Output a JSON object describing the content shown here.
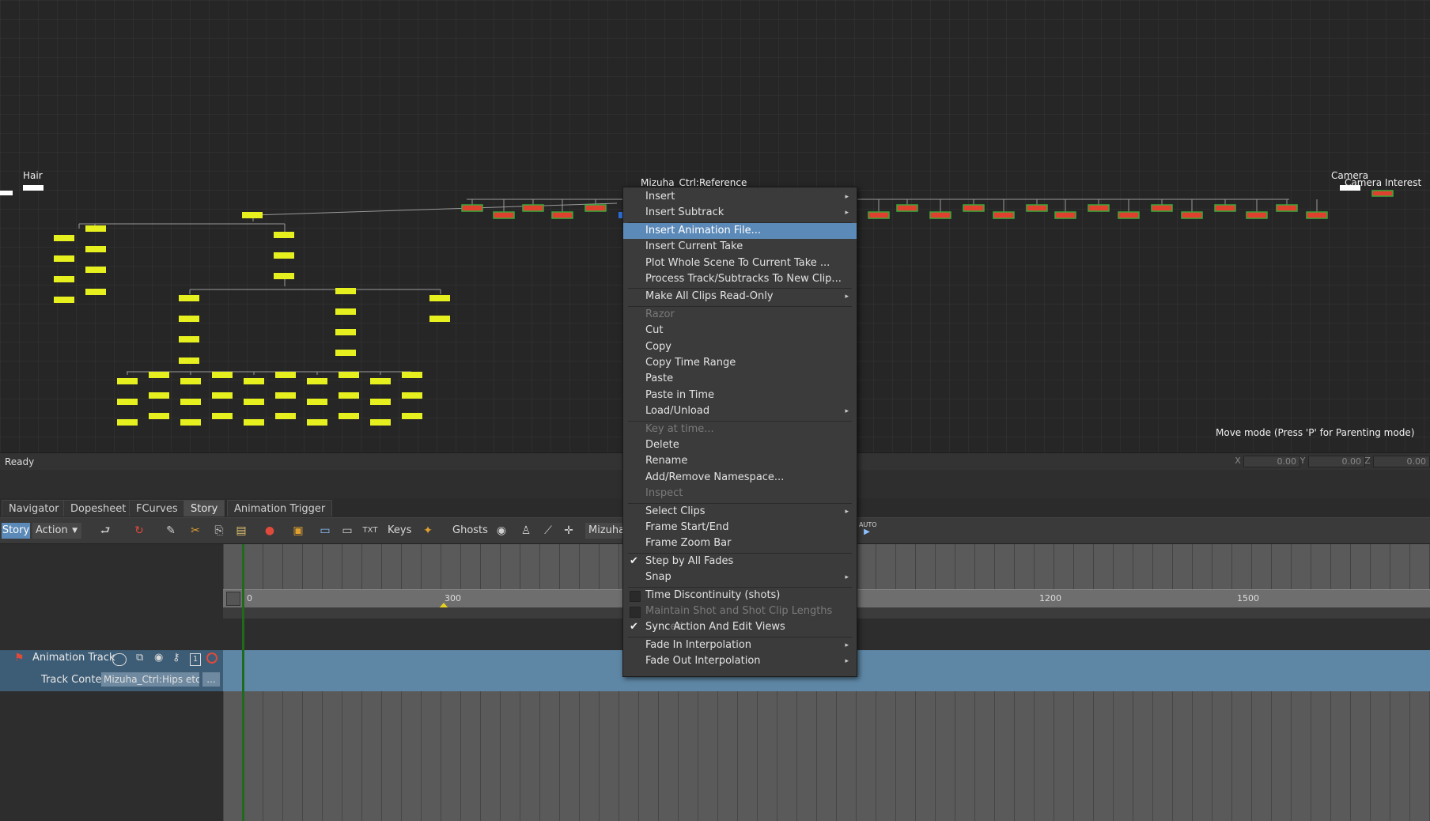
{
  "viewer": {
    "node_labels": {
      "hair": "Hair",
      "reference": "Mizuha_Ctrl:Reference",
      "camera": "Camera",
      "camera_interest": "Camera Interest"
    },
    "mode_hint": "Move mode (Press 'P' for Parenting mode)"
  },
  "status": {
    "text": "Ready",
    "coords": [
      {
        "axis": "X",
        "value": "0.00"
      },
      {
        "axis": "Y",
        "value": "0.00"
      },
      {
        "axis": "Z",
        "value": "0.00"
      }
    ]
  },
  "tabs": [
    "Navigator",
    "Dopesheet",
    "FCurves",
    "Story",
    "Animation Trigger"
  ],
  "active_tab": "Story",
  "toolbar": {
    "story_label": "Story",
    "action_label": "Action",
    "keys_label": "Keys",
    "ghosts_label": "Ghosts",
    "char_label": "Mizuha_",
    "auto_label": "AUTO"
  },
  "ruler": {
    "labels": [
      "0",
      "300",
      "1200",
      "1500"
    ]
  },
  "track": {
    "name": "Animation Track",
    "content_label": "Track Conten",
    "content_value": "Mizuha_Ctrl:Hips etc.",
    "more_label": "..."
  },
  "context_menu": {
    "items": [
      {
        "label": "Insert",
        "submenu": true
      },
      {
        "label": "Insert Subtrack",
        "submenu": true
      },
      {
        "label": "Insert Animation File...",
        "highlight": true
      },
      {
        "label": "Insert Current Take"
      },
      {
        "label": "Plot Whole Scene To Current Take ..."
      },
      {
        "label": "Process Track/Subtracks To New Clip..."
      },
      {
        "label": "Make All Clips Read-Only",
        "submenu": true
      },
      {
        "label": "Razor",
        "disabled": true
      },
      {
        "label": "Cut"
      },
      {
        "label": "Copy"
      },
      {
        "label": "Copy Time Range"
      },
      {
        "label": "Paste"
      },
      {
        "label": "Paste in Time"
      },
      {
        "label": "Load/Unload",
        "submenu": true
      },
      {
        "label": "Key at time...",
        "disabled": true
      },
      {
        "label": "Delete"
      },
      {
        "label": "Rename"
      },
      {
        "label": "Add/Remove Namespace..."
      },
      {
        "label": "Inspect",
        "disabled": true
      },
      {
        "label": "Select Clips",
        "submenu": true
      },
      {
        "label": "Frame Start/End"
      },
      {
        "label": "Frame Zoom Bar"
      },
      {
        "label": "Step by All Fades",
        "checked": true
      },
      {
        "label": "Snap",
        "submenu": true
      },
      {
        "label": "Time Discontinuity (shots)",
        "unchecked": true
      },
      {
        "label": "Maintain Shot and Shot Clip Lengths Synced",
        "disabled": true,
        "unchecked": true
      },
      {
        "label": "Sync Action And Edit Views",
        "checked": true
      },
      {
        "label": "Fade In Interpolation",
        "submenu": true
      },
      {
        "label": "Fade Out Interpolation",
        "submenu": true
      }
    ]
  },
  "colors": {
    "node_yellow": "#e6f01e",
    "node_red": "#e0402e",
    "node_green_border": "#3aa83a",
    "highlight": "#5c8ab8",
    "track_blue": "#5e87a6"
  }
}
